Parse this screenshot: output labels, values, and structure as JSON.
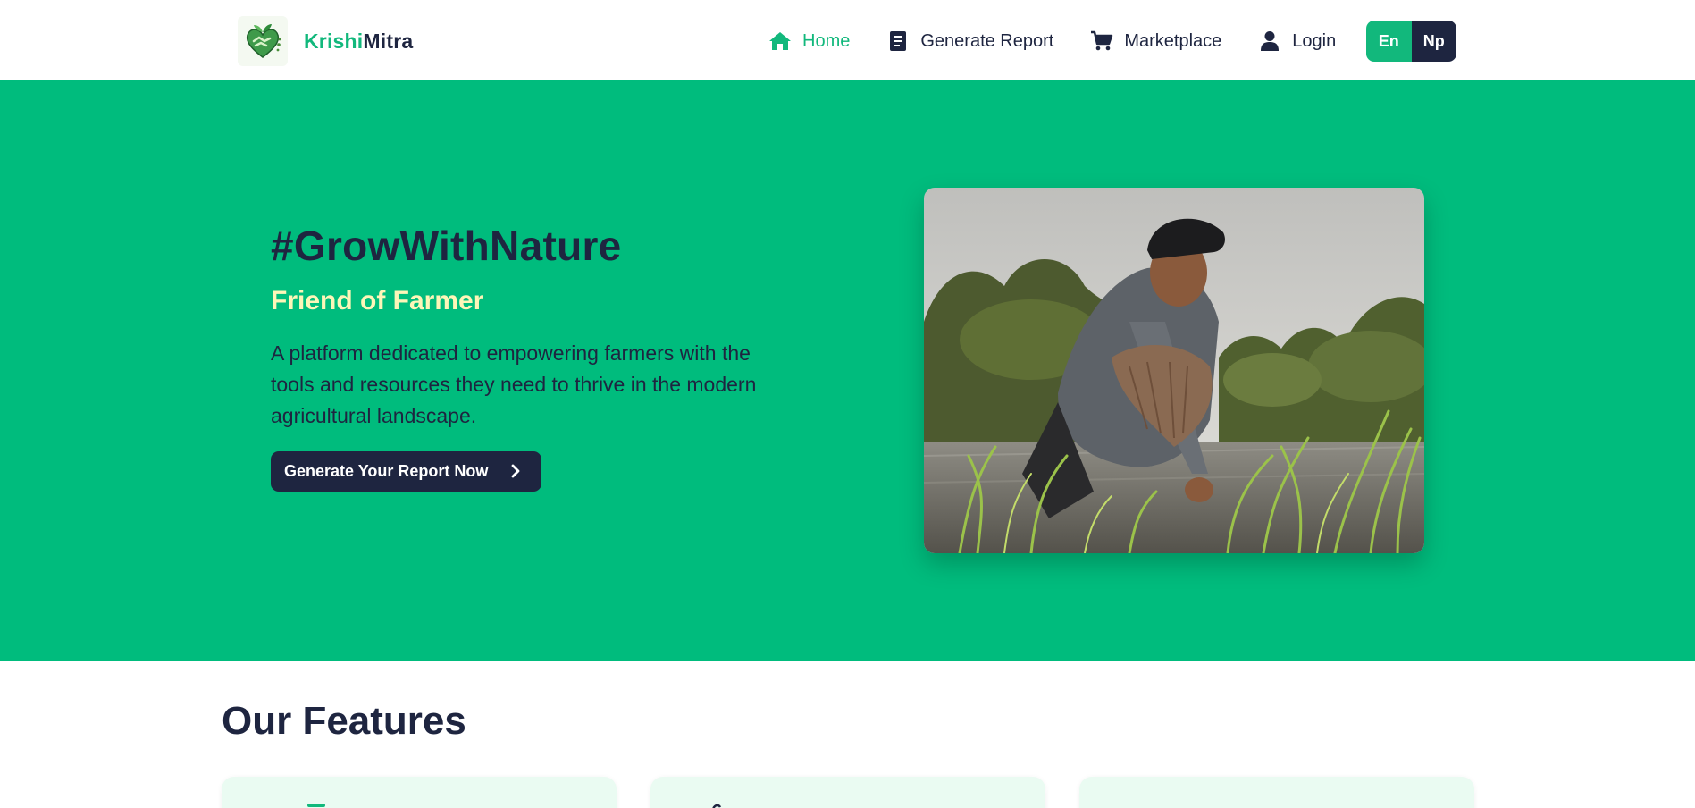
{
  "brand": {
    "name_part1": "Krishi",
    "name_part2": "Mitra"
  },
  "nav": {
    "items": [
      {
        "label": "Home",
        "icon": "home-icon",
        "active": true
      },
      {
        "label": "Generate Report",
        "icon": "document-icon",
        "active": false
      },
      {
        "label": "Marketplace",
        "icon": "cart-icon",
        "active": false
      },
      {
        "label": "Login",
        "icon": "user-icon",
        "active": false
      }
    ],
    "lang": {
      "en": "En",
      "np": "Np",
      "selected": "En"
    }
  },
  "hero": {
    "title": "#GrowWithNature",
    "subtitle": "Friend of Farmer",
    "description": "A platform dedicated to empowering farmers with the tools and resources they need to thrive in the modern agricultural landscape.",
    "cta_label": "Generate Your Report Now"
  },
  "features": {
    "title": "Our Features"
  },
  "colors": {
    "accent": "#12b87c",
    "hero_bg": "#00bc7d",
    "navy": "#1e2540",
    "subtitle": "#fdf6b8",
    "card_bg": "#eafbf2"
  }
}
